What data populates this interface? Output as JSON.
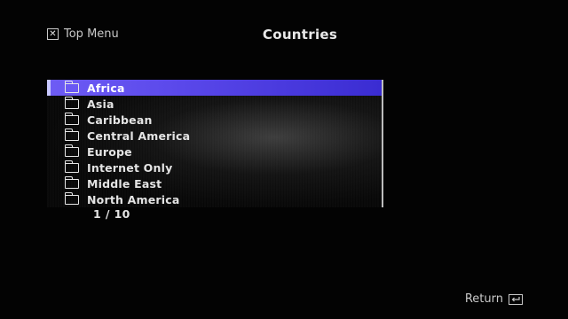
{
  "header": {
    "top_menu_label": "Top Menu",
    "title": "Countries"
  },
  "list": {
    "items": [
      {
        "label": "Africa",
        "icon": "folder-icon",
        "selected": true
      },
      {
        "label": "Asia",
        "icon": "folder-icon"
      },
      {
        "label": "Caribbean",
        "icon": "folder-icon"
      },
      {
        "label": "Central America",
        "icon": "folder-icon"
      },
      {
        "label": "Europe",
        "icon": "folder-icon"
      },
      {
        "label": "Internet Only",
        "icon": "folder-icon"
      },
      {
        "label": "Middle East",
        "icon": "folder-icon"
      },
      {
        "label": "North America",
        "icon": "folder-icon"
      }
    ],
    "page_indicator": "1 / 10"
  },
  "footer": {
    "return_label": "Return"
  },
  "colors": {
    "selection": "#5a48ea",
    "background": "#030303",
    "text": "#e4e4e4"
  }
}
